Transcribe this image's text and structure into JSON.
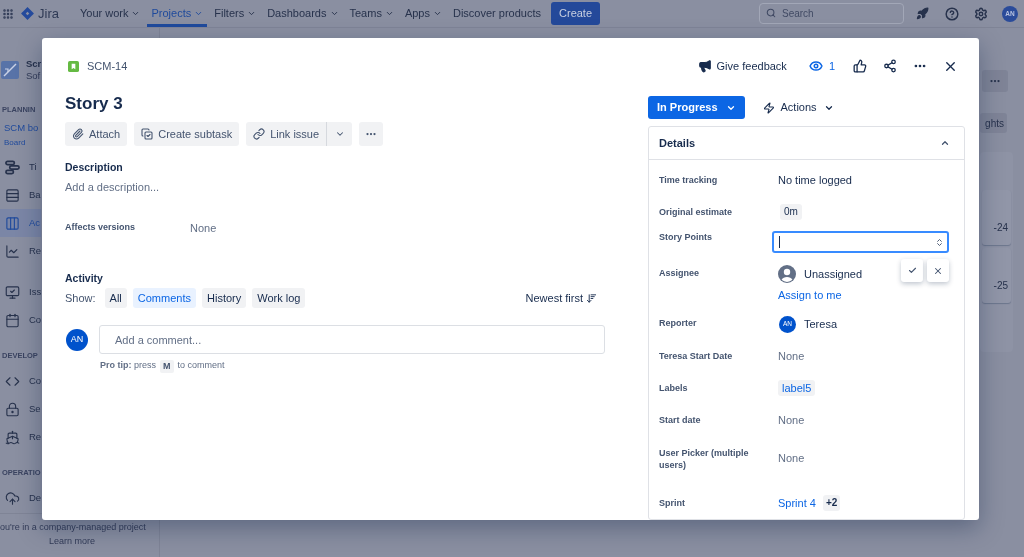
{
  "top_nav": {
    "product": "Jira",
    "items": [
      {
        "label": "Your work",
        "kind": "menu",
        "selected": false
      },
      {
        "label": "Projects",
        "kind": "menu",
        "selected": true
      },
      {
        "label": "Filters",
        "kind": "menu",
        "selected": false
      },
      {
        "label": "Dashboards",
        "kind": "menu",
        "selected": false
      },
      {
        "label": "Teams",
        "kind": "menu",
        "selected": false
      },
      {
        "label": "Apps",
        "kind": "menu",
        "selected": false
      },
      {
        "label": "Discover products",
        "kind": "link",
        "selected": false
      }
    ],
    "create_button": "Create",
    "search": {
      "placeholder": "Search"
    },
    "avatar": "AN"
  },
  "sidebar": {
    "project": {
      "name": "Scr",
      "type": "Sof"
    },
    "sections": [
      {
        "heading": "PLANNIN",
        "board": {
          "name": "SCM bo",
          "type": "Board"
        },
        "items": [
          {
            "label": "Ti",
            "selected": false
          },
          {
            "label": "Ba",
            "selected": false
          },
          {
            "label": "Ac",
            "selected": true
          },
          {
            "label": "Re",
            "selected": false
          }
        ]
      },
      {
        "items": [
          {
            "label": "Iss",
            "selected": false
          },
          {
            "label": "Co",
            "selected": false
          }
        ]
      },
      {
        "heading": "DEVELOP",
        "items": [
          {
            "label": "Co",
            "selected": false
          },
          {
            "label": "Se",
            "selected": false
          },
          {
            "label": "Re",
            "selected": false
          }
        ]
      },
      {
        "heading": "OPERATIO",
        "items": [
          {
            "label": "De",
            "selected": false
          }
        ]
      }
    ],
    "footer": {
      "text": "ou're in a company-managed project",
      "link": "Learn more"
    }
  },
  "board": {
    "insights_button": "ghts",
    "cards": [
      {
        "key": "-24"
      },
      {
        "key": "-25"
      }
    ]
  },
  "issue": {
    "key": "SCM-14",
    "feedback": "Give feedback",
    "watchers": "1",
    "title": "Story 3",
    "toolbar": [
      {
        "label": "Attach",
        "kind": "button"
      },
      {
        "label": "Create subtask",
        "kind": "button"
      },
      {
        "label": "Link issue",
        "kind": "split"
      }
    ],
    "description": {
      "heading": "Description",
      "placeholder": "Add a description..."
    },
    "fields": [
      {
        "label": "Affects versions",
        "value": "None"
      }
    ],
    "activity": {
      "heading": "Activity",
      "show_label": "Show:",
      "filters": [
        {
          "label": "All",
          "selected": false
        },
        {
          "label": "Comments",
          "selected": true
        },
        {
          "label": "History",
          "selected": false
        },
        {
          "label": "Work log",
          "selected": false
        }
      ],
      "sort": "Newest first",
      "comment": {
        "avatar": "AN",
        "placeholder": "Add a comment..."
      },
      "tip": {
        "lead": "**Pro tip:** press",
        "key": "M",
        "tail": "to comment"
      }
    },
    "status": "In Progress",
    "actions": "Actions",
    "details": {
      "heading": "Details",
      "expanded": true,
      "rows": [
        {
          "label": "Time tracking",
          "kind": "text",
          "value": "No time logged"
        },
        {
          "label": "Original estimate",
          "kind": "badge",
          "value": "0m"
        },
        {
          "label": "Story Points",
          "kind": "input",
          "focused": true
        },
        {
          "label": "Assignee",
          "kind": "user",
          "value": "Unassigned",
          "link": "Assign to me"
        },
        {
          "label": "Reporter",
          "kind": "person",
          "avatar": "AN",
          "value": "Teresa"
        },
        {
          "label": "Teresa Start Date",
          "kind": "empty",
          "value": "None"
        },
        {
          "label": "Labels",
          "kind": "tag",
          "value": "label5"
        },
        {
          "label": "Start date",
          "kind": "empty",
          "value": "None"
        },
        {
          "label": "User Picker (multiple users)",
          "kind": "users",
          "value": "None"
        },
        {
          "label": "Sprint",
          "kind": "link",
          "value": "Sprint 4",
          "extra": "+2"
        }
      ]
    }
  }
}
